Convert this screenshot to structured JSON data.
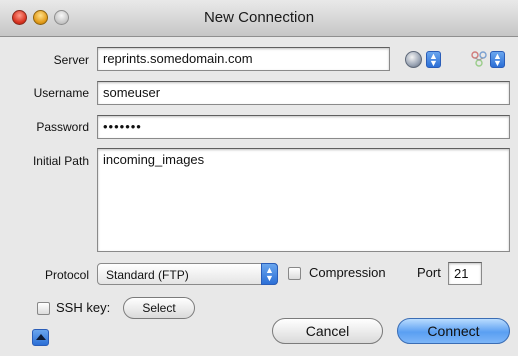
{
  "window": {
    "title": "New Connection"
  },
  "form": {
    "server_label": "Server",
    "server_value": "reprints.somedomain.com",
    "username_label": "Username",
    "username_value": "someuser",
    "password_label": "Password",
    "password_value": "•••••••",
    "initial_path_label": "Initial Path",
    "initial_path_value": "incoming_images",
    "protocol_label": "Protocol",
    "protocol_value": "Standard (FTP)",
    "compression_label": "Compression",
    "compression_checked": false,
    "port_label": "Port",
    "port_value": "21",
    "ssh_key_label": "SSH key:",
    "ssh_key_checked": false,
    "select_label": "Select"
  },
  "buttons": {
    "cancel": "Cancel",
    "connect": "Connect"
  },
  "icons": {
    "bonjour": "bonjour-icon",
    "bookmarks": "bookmark-icon",
    "disclosure": "disclosure-triangle-icon"
  },
  "colors": {
    "accent": "#2c6fd6",
    "window_bg": "#e8e8e8"
  }
}
